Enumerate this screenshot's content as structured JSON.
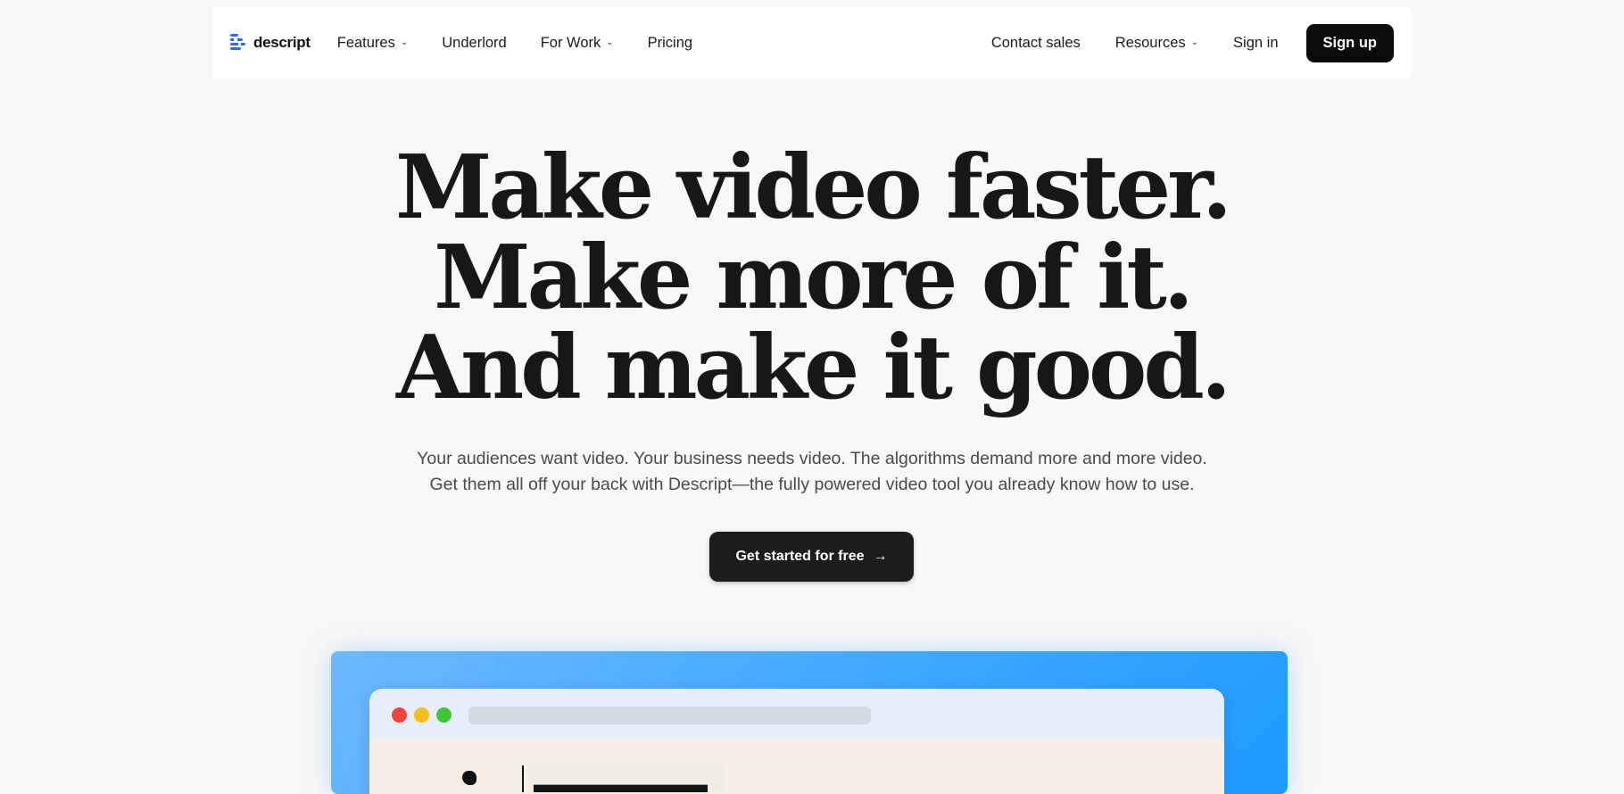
{
  "nav": {
    "logo_text": "descript",
    "logo_icon": "descript-logo-icon",
    "brand_color": "#2a6df4",
    "left_items": [
      {
        "label": "Features",
        "has_dropdown": true
      },
      {
        "label": "Underlord",
        "has_dropdown": false
      },
      {
        "label": "For Work",
        "has_dropdown": true
      },
      {
        "label": "Pricing",
        "has_dropdown": false
      }
    ],
    "right_items": [
      {
        "label": "Contact sales",
        "has_dropdown": false
      },
      {
        "label": "Resources",
        "has_dropdown": true
      },
      {
        "label": "Sign in",
        "has_dropdown": false
      }
    ],
    "signup_label": "Sign up",
    "dropdown_glyph": "⌄"
  },
  "hero": {
    "title_lines": [
      "Make video faster.",
      "Make more of it.",
      "And make it good."
    ],
    "subtitle_lines": [
      "Your audiences want video. Your business needs video. The algorithms demand more and more video.",
      "Get them all off your back with Descript—the fully powered video tool you already know how to use."
    ],
    "cta_label": "Get started for free",
    "cta_arrow": "→"
  },
  "showcase": {
    "window_controls": [
      "close",
      "minimize",
      "maximize"
    ],
    "colors": {
      "close": "#f2443d",
      "minimize": "#f5bf18",
      "maximize": "#41c535",
      "background": "#3aa6ff"
    }
  }
}
